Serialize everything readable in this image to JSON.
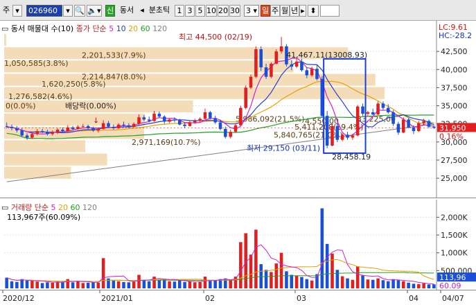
{
  "toolbar": {
    "market": "주",
    "code": "026960",
    "stock_name": "동서",
    "badge": "신",
    "tick_label": "분초틱",
    "periods": [
      "1",
      "3",
      "5",
      "10",
      "20",
      "30"
    ],
    "count": "3",
    "day": "일",
    "week": "주",
    "month": "월",
    "year": "년"
  },
  "price_panel": {
    "title": "동서 매물대 수(10)",
    "ma_label": "종가 단순",
    "ma_periods": [
      "5",
      "10",
      "20",
      "60",
      "120"
    ],
    "lc": "LC:9.61",
    "hc": "HC:-28.2",
    "high_label": "최고 44,500 (02/19)",
    "low_label": "최저 29,150 (03/11)",
    "dividend_label": "배당락(0.00%)",
    "measure_high": "41,467.11(13008.93)",
    "measure_low": "28,458.19",
    "current_price": "31,950",
    "current_pct": "0.16%",
    "y_ticks": [
      "42,500",
      "40,000",
      "37,500",
      "35,000",
      "32,500",
      "30,000",
      "27,500",
      "25,000"
    ],
    "volume_profile": [
      {
        "label": "0(0.0%)",
        "value": 0
      },
      {
        "label": "1,050,585(3.8%)",
        "value": 1050585
      },
      {
        "label": "1,620,250(5.8%)",
        "value": 1620250
      },
      {
        "label": "1,276,582(4.6%)",
        "value": 1276582
      },
      {
        "label": "2,201,533(7.9%)",
        "value": 2201533
      },
      {
        "label": "2,214,847(8.0%)",
        "value": 2214847
      },
      {
        "label": "2,971,169(10.7%)",
        "value": 2971169
      },
      {
        "label": "5,986,092(21.5%)",
        "value": 5986092
      },
      {
        "label": "5,840,765(21.0%)",
        "value": 5840765
      },
      {
        "label": "4,550,00",
        "value": 4550000
      },
      {
        "label": "5,411,208(19.4%)",
        "value": 5411208
      },
      {
        "label": "33,225,00",
        "value": 33225
      }
    ]
  },
  "volume_panel": {
    "title": "거래량",
    "ma_label": "단순",
    "ma_periods": [
      "5",
      "20",
      "60",
      "120"
    ],
    "value_label": "113,967주(60.09%)",
    "y_ticks": [
      "2,000K",
      "1,500K",
      "1,000K",
      "500,000"
    ],
    "current_volume": "113,96",
    "current_pct": "60.09"
  },
  "x_axis": [
    "2020/12",
    "2021/01",
    "02",
    "03",
    "04",
    "04/07"
  ],
  "colors": {
    "up": "#e02020",
    "down": "#1a4fd8",
    "profile": "#f5dcb8",
    "ma5": "#d020d0",
    "ma10": "#2040d0",
    "ma20": "#e8a000",
    "ma60": "#20a020",
    "ma120": "#808080",
    "badge": "#1b3fae"
  },
  "chart_data": {
    "type": "candlestick",
    "price_range": [
      23000,
      45000
    ],
    "volume_range": [
      0,
      2300000
    ],
    "candles": [
      [
        32200,
        32700,
        31900,
        32100,
        300000
      ],
      [
        32100,
        32400,
        31600,
        31900,
        200000
      ],
      [
        31900,
        32200,
        31300,
        31600,
        180000
      ],
      [
        31600,
        31900,
        30700,
        30900,
        260000
      ],
      [
        30900,
        31200,
        30300,
        30600,
        220000
      ],
      [
        30600,
        31300,
        30400,
        31100,
        210000
      ],
      [
        31100,
        31800,
        30900,
        31500,
        190000
      ],
      [
        31500,
        31800,
        31200,
        31400,
        150000
      ],
      [
        31400,
        31700,
        30900,
        31100,
        170000
      ],
      [
        31100,
        31600,
        30900,
        31300,
        160000
      ],
      [
        31300,
        31900,
        31100,
        31700,
        190000
      ],
      [
        31700,
        32000,
        31300,
        31500,
        180000
      ],
      [
        31500,
        32300,
        31400,
        32000,
        260000
      ],
      [
        32000,
        32200,
        31600,
        31800,
        170000
      ],
      [
        31800,
        32300,
        31700,
        32100,
        200000
      ],
      [
        32100,
        32500,
        31900,
        32200,
        150000
      ],
      [
        32200,
        32400,
        31700,
        31900,
        160000
      ],
      [
        31900,
        32100,
        31400,
        31600,
        170000
      ],
      [
        31600,
        32000,
        31300,
        31800,
        160000
      ],
      [
        31800,
        33000,
        31700,
        32600,
        850000
      ],
      [
        32600,
        32900,
        31900,
        32100,
        280000
      ],
      [
        32100,
        32400,
        31700,
        31900,
        220000
      ],
      [
        31900,
        32600,
        31800,
        32400,
        200000
      ],
      [
        32400,
        32800,
        32000,
        32300,
        180000
      ],
      [
        32300,
        32600,
        31900,
        32100,
        170000
      ],
      [
        32100,
        32700,
        32000,
        32500,
        190000
      ],
      [
        32500,
        33800,
        32300,
        33400,
        380000
      ],
      [
        33400,
        33700,
        32900,
        33100,
        240000
      ],
      [
        33100,
        33500,
        32700,
        32900,
        200000
      ],
      [
        32900,
        34300,
        32800,
        33900,
        330000
      ],
      [
        33900,
        34200,
        33300,
        33500,
        250000
      ],
      [
        33500,
        33700,
        32500,
        32800,
        270000
      ],
      [
        32800,
        33300,
        32600,
        33100,
        200000
      ],
      [
        33100,
        33400,
        32700,
        33000,
        190000
      ],
      [
        33000,
        33200,
        32300,
        32400,
        230000
      ],
      [
        32400,
        32700,
        31900,
        32200,
        180000
      ],
      [
        32200,
        32900,
        32100,
        32700,
        200000
      ],
      [
        32700,
        33200,
        32500,
        32900,
        170000
      ],
      [
        32900,
        33400,
        32700,
        33200,
        180000
      ],
      [
        33200,
        34600,
        33100,
        34100,
        330000
      ],
      [
        34100,
        34300,
        33100,
        33300,
        210000
      ],
      [
        33300,
        33600,
        32500,
        32700,
        220000
      ],
      [
        32700,
        33000,
        31600,
        31800,
        260000
      ],
      [
        31800,
        32100,
        30500,
        30700,
        280000
      ],
      [
        30700,
        31700,
        30500,
        31400,
        240000
      ],
      [
        31400,
        32600,
        31300,
        32300,
        330000
      ],
      [
        32300,
        35000,
        32200,
        34700,
        1300000
      ],
      [
        34700,
        37800,
        34500,
        37500,
        1550000
      ],
      [
        37500,
        39300,
        37300,
        39000,
        950000
      ],
      [
        39000,
        43200,
        38800,
        42800,
        1650000
      ],
      [
        42800,
        43200,
        39800,
        40300,
        680000
      ],
      [
        40300,
        40800,
        38700,
        39000,
        520000
      ],
      [
        39000,
        41000,
        38800,
        40800,
        460000
      ],
      [
        40800,
        42800,
        40700,
        42500,
        700000
      ],
      [
        42500,
        44500,
        42200,
        43200,
        1000000
      ],
      [
        43200,
        43500,
        40400,
        40700,
        480000
      ],
      [
        40700,
        41300,
        39900,
        40400,
        380000
      ],
      [
        40400,
        41500,
        40200,
        41100,
        350000
      ],
      [
        41100,
        41500,
        39700,
        39900,
        320000
      ],
      [
        39900,
        40300,
        38800,
        39200,
        260000
      ],
      [
        39200,
        40400,
        39000,
        40100,
        220000
      ],
      [
        40100,
        40600,
        38500,
        38700,
        400000
      ],
      [
        38700,
        39100,
        33300,
        33600,
        2250000
      ],
      [
        33600,
        34300,
        29150,
        29500,
        1250000
      ],
      [
        29500,
        32700,
        29400,
        32200,
        980000
      ],
      [
        32200,
        32600,
        30000,
        30300,
        520000
      ],
      [
        30300,
        31200,
        30100,
        31000,
        340000
      ],
      [
        31000,
        31400,
        30300,
        30600,
        280000
      ],
      [
        30600,
        31100,
        30300,
        30900,
        240000
      ],
      [
        30900,
        35100,
        30800,
        34900,
        620000
      ],
      [
        34900,
        35300,
        33600,
        33900,
        360000
      ],
      [
        33900,
        34300,
        33500,
        34100,
        250000
      ],
      [
        34100,
        34600,
        33700,
        33800,
        240000
      ],
      [
        33800,
        35600,
        33700,
        35300,
        280000
      ],
      [
        35300,
        35600,
        34400,
        34700,
        230000
      ],
      [
        34700,
        35200,
        33900,
        34100,
        200000
      ],
      [
        34100,
        34400,
        32200,
        32500,
        260000
      ],
      [
        32500,
        32800,
        31000,
        31300,
        230000
      ],
      [
        31300,
        33400,
        31200,
        33100,
        200000
      ],
      [
        33100,
        33300,
        31900,
        32000,
        160000
      ],
      [
        32000,
        32300,
        31100,
        31500,
        130000
      ],
      [
        31500,
        32900,
        31400,
        32600,
        120000
      ],
      [
        32600,
        33200,
        32300,
        32900,
        140000
      ],
      [
        32900,
        33100,
        31900,
        32100,
        110000
      ],
      [
        32100,
        32300,
        31800,
        31950,
        113967
      ]
    ]
  }
}
